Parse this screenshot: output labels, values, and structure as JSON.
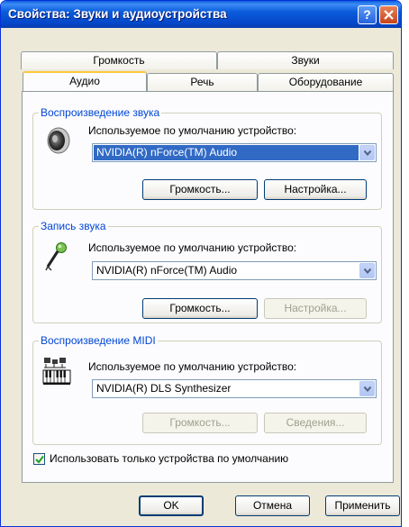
{
  "window": {
    "title": "Свойства: Звуки и аудиоустройства",
    "help_label": "?",
    "close_icon": "close-icon"
  },
  "tabs": {
    "back_row": [
      "Громкость",
      "Звуки"
    ],
    "front_row": [
      "Аудио",
      "Речь",
      "Оборудование"
    ],
    "active": "Аудио"
  },
  "playback": {
    "title": "Воспроизведение звука",
    "device_label": "Используемое по умолчанию устройство:",
    "device_value": "NVIDIA(R) nForce(TM) Audio",
    "volume_button": "Громкость...",
    "settings_button": "Настройка...",
    "icon": "speaker-icon"
  },
  "recording": {
    "title": "Запись звука",
    "device_label": "Используемое по умолчанию устройство:",
    "device_value": "NVIDIA(R) nForce(TM) Audio",
    "volume_button": "Громкость...",
    "settings_button": "Настройка...",
    "icon": "microphone-icon"
  },
  "midi": {
    "title": "Воспроизведение MIDI",
    "device_label": "Используемое по умолчанию устройство:",
    "device_value": "NVIDIA(R) DLS Synthesizer",
    "volume_button": "Громкость...",
    "info_button": "Сведения...",
    "icon": "midi-keyboard-icon"
  },
  "only_default_checkbox": {
    "label": "Использовать только устройства по умолчанию",
    "checked": true
  },
  "footer": {
    "ok": "OK",
    "cancel": "Отмена",
    "apply": "Применить"
  },
  "colors": {
    "title_bar": "#0A5FDC",
    "dialog_bg": "#ECE9D8",
    "group_title": "#0046D5",
    "selection": "#316AC5",
    "tab_highlight": "#FFC83C"
  }
}
